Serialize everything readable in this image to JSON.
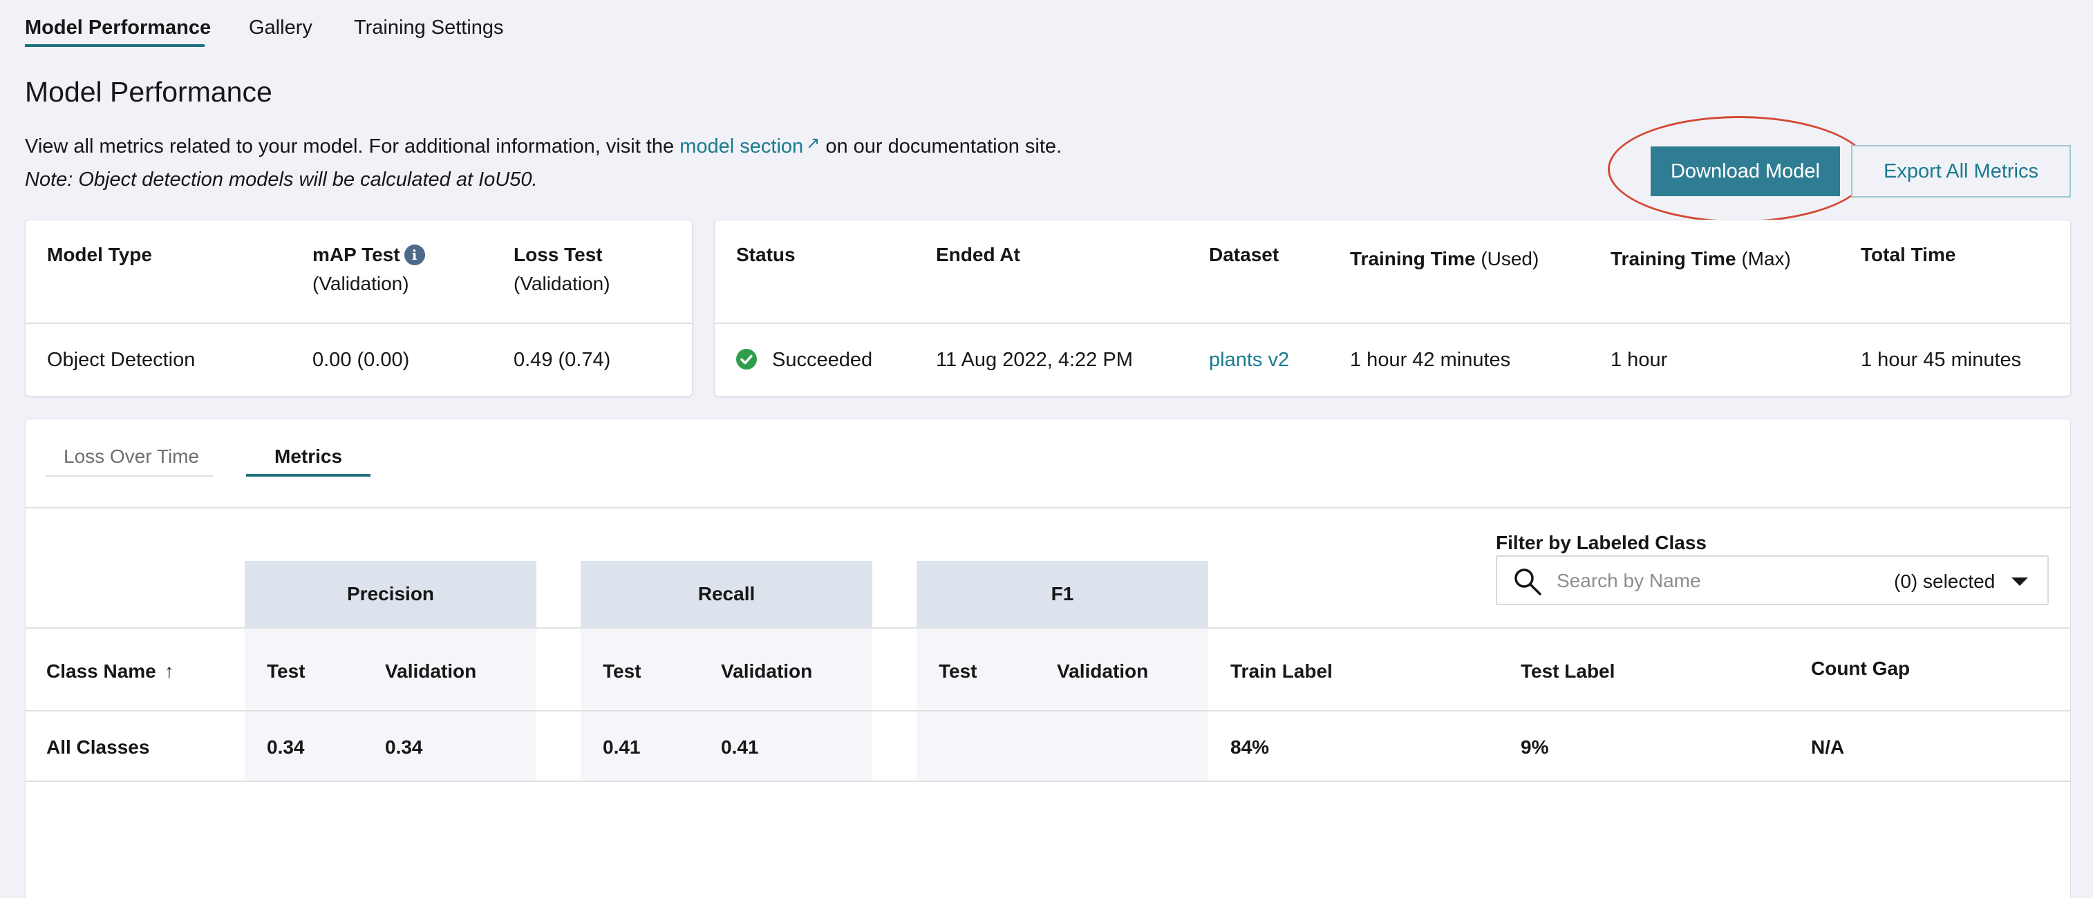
{
  "tabs": {
    "model_performance": "Model Performance",
    "gallery": "Gallery",
    "training_settings": "Training Settings"
  },
  "page": {
    "title": "Model Performance",
    "desc_before": "View all metrics related to your model. For additional information, visit the ",
    "desc_link": "model section",
    "desc_after": " on our documentation site.",
    "note": "Note: Object detection models will be calculated at IoU50."
  },
  "actions": {
    "download": "Download Model",
    "export": "Export All Metrics"
  },
  "model_card": {
    "h_type": "Model Type",
    "h_map": "mAP Test",
    "h_map_sub": "(Validation)",
    "h_loss": "Loss Test",
    "h_loss_sub": "(Validation)",
    "type": "Object Detection",
    "map": "0.00 (0.00)",
    "loss": "0.49 (0.74)"
  },
  "status_card": {
    "h_status": "Status",
    "h_ended": "Ended At",
    "h_dataset": "Dataset",
    "h_train_used": "Training Time",
    "h_train_used_sub": "(Used)",
    "h_train_max": "Training Time",
    "h_train_max_sub": "(Max)",
    "h_total": "Total Time",
    "status": "Succeeded",
    "ended": "11 Aug 2022, 4:22 PM",
    "dataset": "plants v2",
    "train_used": "1 hour 42 minutes",
    "train_max": "1 hour",
    "total": "1 hour 45 minutes"
  },
  "subtabs": {
    "loss": "Loss Over Time",
    "metrics": "Metrics"
  },
  "filter": {
    "label": "Filter by Labeled Class",
    "placeholder": "Search by Name",
    "count": "(0) selected"
  },
  "metrics_table": {
    "groups": {
      "precision": "Precision",
      "recall": "Recall",
      "f1": "F1"
    },
    "columns": {
      "class_name": "Class Name",
      "p_test": "Test",
      "p_val": "Validation",
      "r_test": "Test",
      "r_val": "Validation",
      "f_test": "Test",
      "f_val": "Validation",
      "train_label": "Train Label",
      "test_label": "Test Label",
      "count_gap": "Count Gap"
    },
    "rows": [
      {
        "class_name": "All Classes",
        "p_test": "0.34",
        "p_val": "0.34",
        "r_test": "0.41",
        "r_val": "0.41",
        "f_test": "",
        "f_val": "",
        "train_label": "84%",
        "test_label": "9%",
        "count_gap": "N/A"
      }
    ]
  },
  "colors": {
    "accent": "#2f7d92",
    "link": "#1b7b8f",
    "success": "#2e9e4c",
    "annotation": "#d44a35"
  },
  "icons": {
    "external": "external-link-icon",
    "info": "info-icon",
    "status": "check-circle-icon",
    "sort": "sort-ascending-icon",
    "search": "search-icon",
    "dropdown": "chevron-down-icon"
  }
}
